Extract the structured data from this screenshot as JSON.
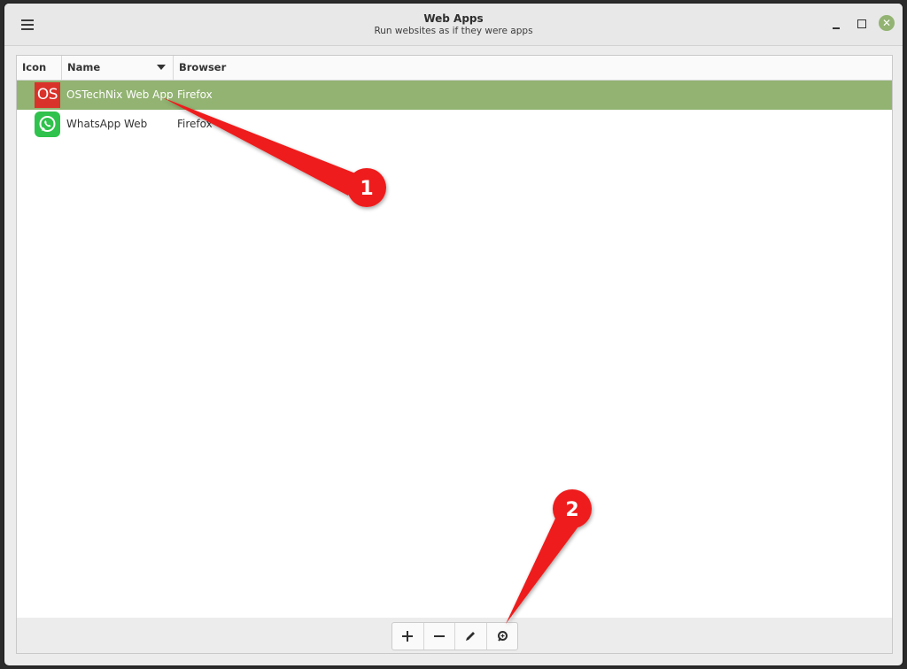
{
  "window": {
    "title": "Web Apps",
    "subtitle": "Run websites as if they were apps"
  },
  "columns": {
    "icon": "Icon",
    "name": "Name",
    "browser": "Browser"
  },
  "rows": [
    {
      "icon": "os-logo-icon",
      "icon_text": "OS",
      "name": "OSTechNix Web App",
      "browser": "Firefox",
      "selected": true
    },
    {
      "icon": "whatsapp-icon",
      "name": "WhatsApp Web",
      "browser": "Firefox",
      "selected": false
    }
  ],
  "toolbar": [
    {
      "icon": "add-icon"
    },
    {
      "icon": "remove-icon"
    },
    {
      "icon": "edit-icon"
    },
    {
      "icon": "launch-icon"
    }
  ],
  "annotations": [
    {
      "label": "1"
    },
    {
      "label": "2"
    }
  ],
  "colors": {
    "accent": "#92b372",
    "annotation": "#ee1d1d"
  }
}
